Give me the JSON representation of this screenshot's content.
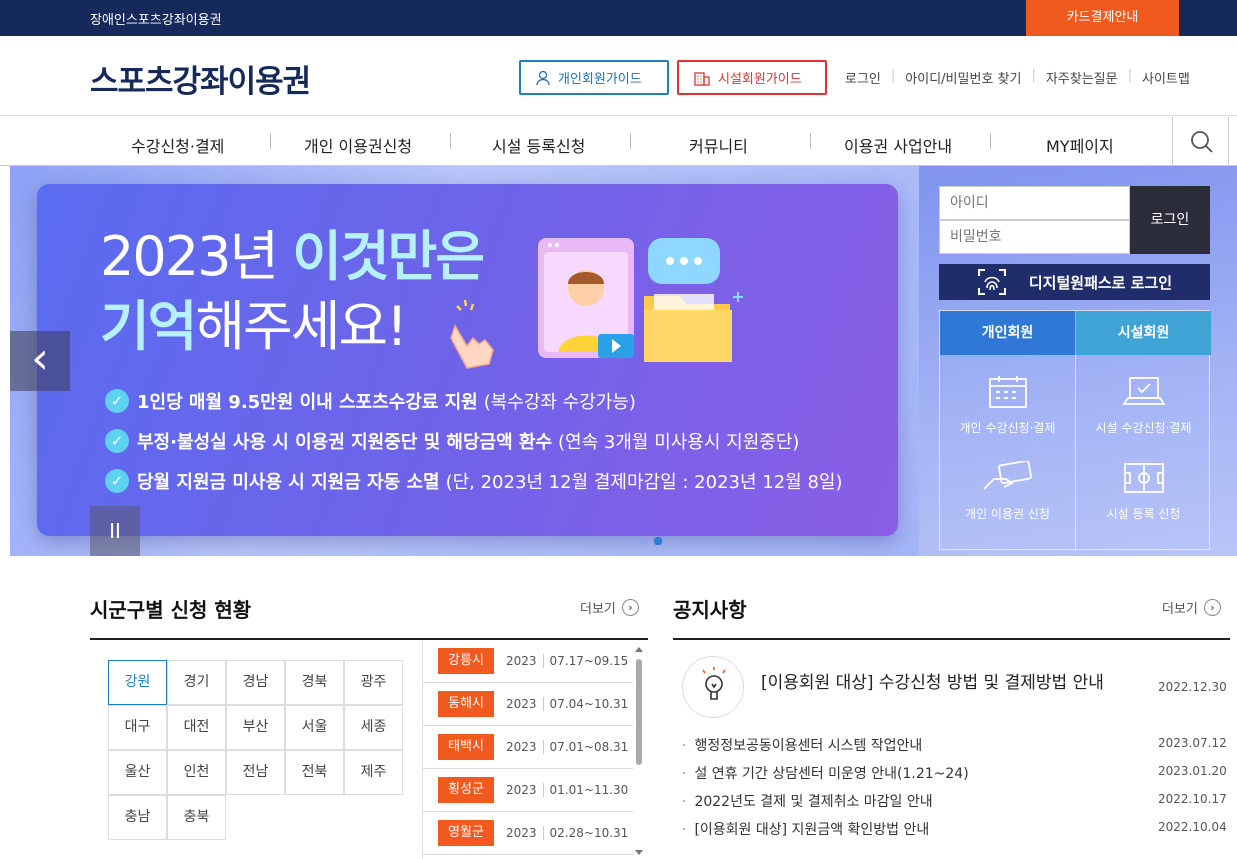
{
  "topbar": {
    "site_name": "장애인스포츠강좌이용권",
    "card_label": "카드결제안내"
  },
  "header": {
    "logo": "스포츠강좌이용권",
    "personal_guide": "개인회원가이드",
    "facility_guide": "시설회원가이드",
    "links": [
      "로그인",
      "아이디/비밀번호 찾기",
      "자주찾는질문",
      "사이트맵"
    ]
  },
  "nav": {
    "items": [
      "수강신청·결제",
      "개인 이용권신청",
      "시설 등록신청",
      "커뮤니티",
      "이용권 사업안내",
      "MY페이지"
    ]
  },
  "banner": {
    "line1_a": "2023년 ",
    "line1_b": "이것만은",
    "line2_a": "기억",
    "line2_b": "해주세요!",
    "bullets": [
      {
        "strong": "1인당 매월 9.5만원 이내 스포츠수강료 지원",
        "sub": "(복수강좌 수강가능)"
      },
      {
        "strong": "부정·불성실 사용 시 이용권 지원중단 및 해당금액 환수",
        "sub": "(연속 3개월 미사용시 지원중단)"
      },
      {
        "strong": "당월 지원금 미사용 시 지원금 자동 소멸",
        "sub": "(단, 2023년 12월 결제마감일 : 2023년 12월 8일)"
      }
    ],
    "prev_label": "‹",
    "pause_label": "II"
  },
  "login": {
    "id_placeholder": "아이디",
    "pw_placeholder": "비밀번호",
    "login_btn": "로그인",
    "digital_pass": "디지털원패스로 로그인",
    "tab_personal": "개인회원",
    "tab_facility": "시설회원",
    "menu": [
      "개인 수강신청·결제",
      "시설 수강신청·결제",
      "개인 이용권 신청",
      "시설 등록 신청"
    ]
  },
  "region": {
    "title": "시군구별 신청 현황",
    "more": "더보기",
    "cells": [
      "강원",
      "경기",
      "경남",
      "경북",
      "광주",
      "대구",
      "대전",
      "부산",
      "서울",
      "세종",
      "울산",
      "인천",
      "전남",
      "전북",
      "제주",
      "충남",
      "충북"
    ],
    "rows": [
      {
        "city": "강릉시",
        "year": "2023",
        "period": "07.17~09.15"
      },
      {
        "city": "동해시",
        "year": "2023",
        "period": "07.04~10.31"
      },
      {
        "city": "태백시",
        "year": "2023",
        "period": "07.01~08.31"
      },
      {
        "city": "횡성군",
        "year": "2023",
        "period": "01.01~11.30"
      },
      {
        "city": "영월군",
        "year": "2023",
        "period": "02.28~10.31"
      }
    ]
  },
  "notice": {
    "title": "공지사항",
    "more": "더보기",
    "top": {
      "title": "[이용회원 대상] 수강신청 방법 및 결제방법 안내",
      "date": "2022.12.30"
    },
    "items": [
      {
        "title": "행정정보공동이용센터 시스템 작업안내",
        "date": "2023.07.12"
      },
      {
        "title": "설 연휴 기간 상담센터 미운영 안내(1.21~24)",
        "date": "2023.01.20"
      },
      {
        "title": "2022년도 결제 및 결제취소 마감일 안내",
        "date": "2022.10.17"
      },
      {
        "title": "[이용회원 대상] 지원금액 확인방법 안내",
        "date": "2022.10.04"
      }
    ]
  }
}
